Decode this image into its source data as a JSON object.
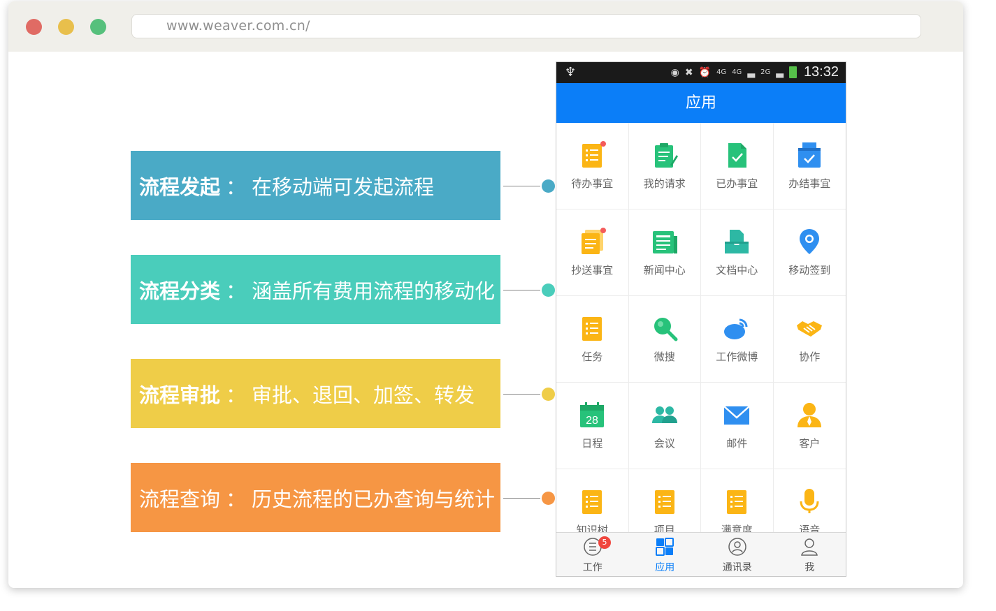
{
  "browser": {
    "url": "www.weaver.com.cn/"
  },
  "features": [
    {
      "title": "流程发起",
      "sep": "：",
      "desc": "在移动端可发起流程",
      "color": "#4aaac6"
    },
    {
      "title": "流程分类",
      "sep": "：",
      "desc": "涵盖所有费用流程的移动化",
      "color": "#4acdbb"
    },
    {
      "title": "流程审批",
      "sep": "：",
      "desc": "审批、退回、加签、转发",
      "color": "#efcd48"
    },
    {
      "title": "流程查询",
      "sep": "：",
      "desc": "历史流程的已办查询与统计",
      "color": "#f69644"
    }
  ],
  "phone": {
    "status": {
      "time": "13:32",
      "net1": "4G",
      "net2": "4G",
      "net3": "2G"
    },
    "header_title": "应用",
    "apps": [
      {
        "label": "待办事宜",
        "icon": "todo-list-icon"
      },
      {
        "label": "我的请求",
        "icon": "request-icon"
      },
      {
        "label": "已办事宜",
        "icon": "done-doc-icon"
      },
      {
        "label": "办结事宜",
        "icon": "finished-icon"
      },
      {
        "label": "抄送事宜",
        "icon": "cc-icon"
      },
      {
        "label": "新闻中心",
        "icon": "news-icon"
      },
      {
        "label": "文档中心",
        "icon": "document-center-icon"
      },
      {
        "label": "移动签到",
        "icon": "location-pin-icon"
      },
      {
        "label": "任务",
        "icon": "task-icon"
      },
      {
        "label": "微搜",
        "icon": "search-icon"
      },
      {
        "label": "工作微博",
        "icon": "weibo-icon"
      },
      {
        "label": "协作",
        "icon": "handshake-icon"
      },
      {
        "label": "日程",
        "icon": "calendar-icon",
        "day": "28"
      },
      {
        "label": "会议",
        "icon": "meeting-icon"
      },
      {
        "label": "邮件",
        "icon": "mail-icon"
      },
      {
        "label": "客户",
        "icon": "customer-icon"
      },
      {
        "label": "知识树",
        "icon": "knowledge-icon"
      },
      {
        "label": "项目",
        "icon": "project-icon"
      },
      {
        "label": "满意度",
        "icon": "satisfaction-icon"
      },
      {
        "label": "语音",
        "icon": "microphone-icon"
      }
    ],
    "tabs": [
      {
        "label": "工作",
        "badge": "5"
      },
      {
        "label": "应用"
      },
      {
        "label": "通讯录"
      },
      {
        "label": "我"
      }
    ]
  },
  "colors": {
    "accent_blue": "#0b7ef8",
    "icon_orange": "#fbb515",
    "icon_green": "#27c27a",
    "icon_teal": "#2db8a4",
    "icon_blue": "#2f8ff0"
  }
}
